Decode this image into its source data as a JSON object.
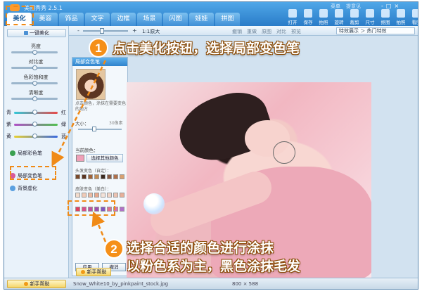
{
  "app": {
    "title": "美图秀秀 2.5.1",
    "menu_tabs": [
      "美化",
      "美容",
      "饰品",
      "文字",
      "边框",
      "场景",
      "闪图",
      "娃娃",
      "拼图"
    ],
    "top_links": [
      "菜单",
      "提意见"
    ],
    "window_buttons": [
      "-",
      "□",
      "×"
    ],
    "toolbar": [
      "打开",
      "保存",
      "拍照",
      "旋转",
      "裁剪",
      "尺寸",
      "抠图",
      "拍照",
      "看图"
    ]
  },
  "sidebar": {
    "head_button": "一键美化",
    "sliders": [
      "亮度",
      "对比度",
      "色彩饱和度",
      "清晰度"
    ],
    "color_rows": [
      {
        "left": "青",
        "right": "红"
      },
      {
        "left": "紫",
        "right": "绿"
      },
      {
        "left": "黄",
        "right": "蓝"
      }
    ],
    "items": [
      "局部彩色笔",
      "局部变色笔",
      "背景虚化"
    ],
    "help_button": "新手帮助"
  },
  "view_toolbar": {
    "zoom_minus": "-",
    "zoom_plus": "+",
    "zoom_label": "1:1原大",
    "buttons": [
      "撤销",
      "重做",
      "原图",
      "对比",
      "预览"
    ],
    "effects_box": "特效展示 ＞ 热门特效"
  },
  "panel": {
    "title": "局部变色笔",
    "description": "点击颜色，涂抹在需要变色的地方",
    "pen_size_label": "大小：",
    "pen_size_value": "30像素",
    "current_color_label": "当前颜色：",
    "other_color_button": "选择其他颜色",
    "swatch_titles": [
      "头发变色（自定）：",
      "皮肤变色（美白）："
    ],
    "swatch_rows": [
      [
        "#7a4a2a",
        "#5a3420",
        "#a06238",
        "#c28a52",
        "#3a2a20",
        "#8a5a42",
        "#b0704a",
        "#d8a070"
      ],
      [
        "#f3dccc",
        "#f0cbb8",
        "#ecbaa2",
        "#e8a88c",
        "#f4e2d8",
        "#f2d4c6",
        "#ecc2b0",
        "#e6b09a"
      ],
      [
        "#e04060",
        "#d8508a",
        "#c050a0",
        "#a050b0",
        "#8058c0",
        "#e07090",
        "#d870b0",
        "#b070c8"
      ]
    ],
    "apply_button": "应用",
    "cancel_button": "撤消"
  },
  "status": {
    "filename": "Snow_White10_by_pinkpaint_stock.jpg",
    "size": "800 × 588",
    "new_help": "新手帮助"
  },
  "annotations": {
    "step1_number": "1",
    "step1_text": "点击美化按钮，选择局部变色笔",
    "step2_number": "2",
    "step2_line1": "选择合适的颜色进行涂抹",
    "step2_line2": "以粉色系为主，黑色涂抹毛发"
  },
  "colors": {
    "accent": "#f58f18",
    "title_bar": "#2a7cc8"
  }
}
